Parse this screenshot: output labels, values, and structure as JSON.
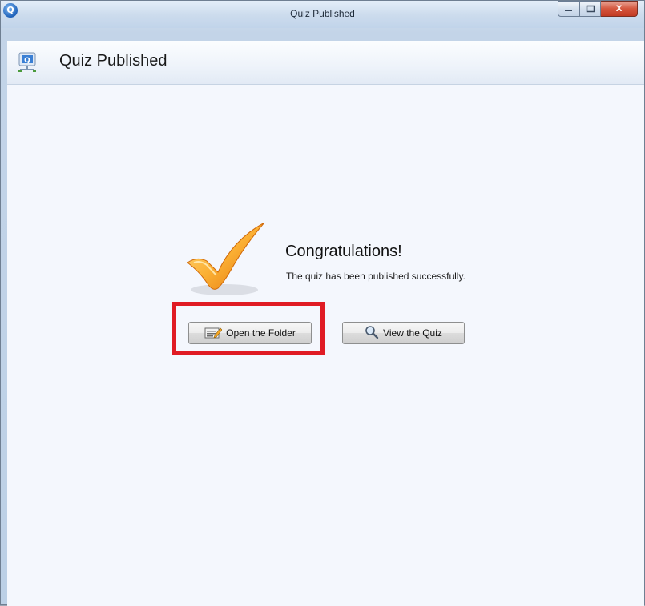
{
  "window": {
    "title": "Quiz Published",
    "app_icon_letter": "Q",
    "controls": {
      "minimize": "—",
      "maximize": "□",
      "close": "X"
    }
  },
  "header": {
    "title": "Quiz  Published"
  },
  "main": {
    "heading": "Congratulations!",
    "message": "The quiz has been published successfully.",
    "buttons": {
      "open_folder": "Open the Folder",
      "view_quiz": "View the Quiz"
    }
  },
  "colors": {
    "highlight": "#e01b24",
    "check_light": "#ffd36b",
    "check_dark": "#f08a0e",
    "content_bg": "#f4f7fd"
  },
  "icons": {
    "app": "quiz-app-icon",
    "header": "quiz-network-icon",
    "success": "checkmark-icon",
    "open_folder": "folder-edit-icon",
    "view_quiz": "magnifier-icon"
  }
}
